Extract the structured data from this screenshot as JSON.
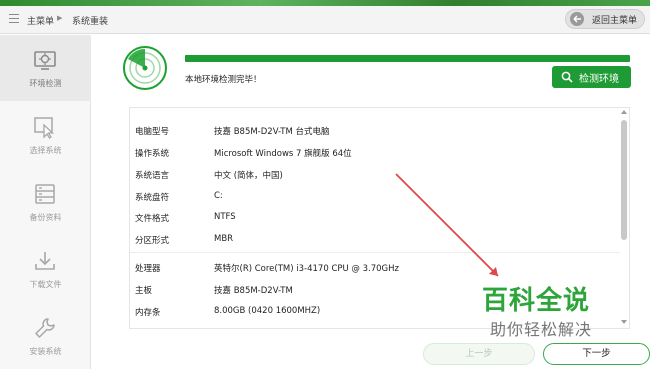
{
  "header": {
    "menu_icon": "list-icon",
    "breadcrumb_main": "主菜单",
    "breadcrumb_current": "系统重装",
    "back_button": "返回主菜单"
  },
  "sidebar": {
    "items": [
      {
        "label": "环境检测",
        "icon": "environment-check-icon",
        "active": true
      },
      {
        "label": "选择系统",
        "icon": "select-system-icon",
        "active": false
      },
      {
        "label": "备份资料",
        "icon": "backup-icon",
        "active": false
      },
      {
        "label": "下载文件",
        "icon": "download-icon",
        "active": false
      },
      {
        "label": "安装系统",
        "icon": "install-wrench-icon",
        "active": false
      }
    ]
  },
  "detection": {
    "progress_percent": 100,
    "status_text": "本地环境检测完毕！",
    "button_label": "检测环境",
    "accent_color": "#1f9b36"
  },
  "info": {
    "rows": [
      {
        "key": "电脑型号",
        "value": "技嘉 B85M-D2V-TM 台式电脑"
      },
      {
        "key": "操作系统",
        "value": "Microsoft Windows 7 旗舰版  64位"
      },
      {
        "key": "系统语言",
        "value": "中文 (简体，中国)"
      },
      {
        "key": "系统盘符",
        "value": "C:"
      },
      {
        "key": "文件格式",
        "value": "NTFS"
      },
      {
        "key": "分区形式",
        "value": "MBR"
      },
      {
        "key": "处理器",
        "value": "英特尔(R) Core(TM) i3-4170 CPU @ 3.70GHz"
      },
      {
        "key": "主板",
        "value": "技嘉 B85M-D2V-TM"
      },
      {
        "key": "内存条",
        "value": "8.00GB (0420  1600MHZ)"
      }
    ]
  },
  "watermark": {
    "title": "百科全说",
    "subtitle": "助你轻松解决"
  },
  "footer": {
    "prev_label": "上一步",
    "next_label": "下一步"
  }
}
